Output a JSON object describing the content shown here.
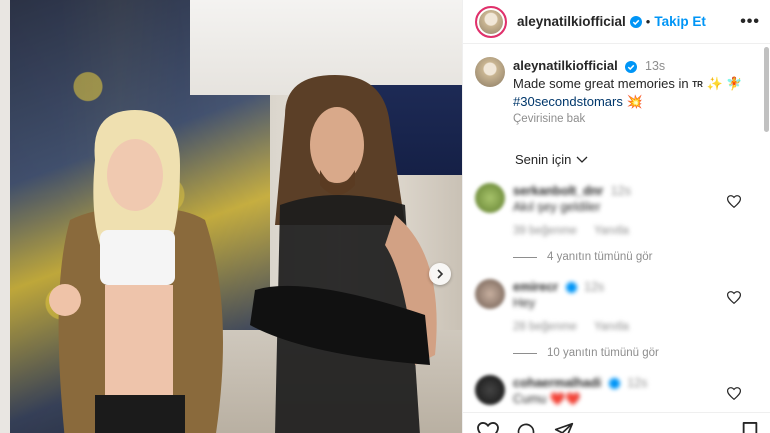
{
  "header": {
    "username": "aleynatilkiofficial",
    "separator": "•",
    "follow_label": "Takip Et",
    "more_label": "•••"
  },
  "caption": {
    "username": "aleynatilkiofficial",
    "time": "13s",
    "text": "Made some great memories in",
    "flag": "TR",
    "emojis": "✨ 🧚",
    "hashtag": "#30secondstomars",
    "hashtag_emoji": "💥",
    "translate": "Çevirisine bak"
  },
  "filter": {
    "label": "Senin için"
  },
  "comments": [
    {
      "username": "serkanbolt_dnr",
      "time": "12s",
      "text": "Akıl şey geldiler",
      "likes": "39 beğenme",
      "reply": "Yanıtla",
      "replies": "4 yanıtın tümünü gör"
    },
    {
      "username": "emirecr",
      "time": "12s",
      "text": "Hey",
      "likes": "28 beğenme",
      "reply": "Yanıtla",
      "replies": "10 yanıtın tümünü gör"
    },
    {
      "username": "cohaermalhadi",
      "time": "12s",
      "text": "Cumu ❤️❤️",
      "likes": "",
      "reply": "",
      "replies": ""
    }
  ],
  "colors": {
    "link": "#0095f6",
    "hashtag": "#00376b",
    "muted": "#8e8e8e",
    "ring": "#e1306c"
  },
  "icons": [
    "verified-badge-icon",
    "chevron-down-icon",
    "heart-icon",
    "comment-icon",
    "share-icon",
    "bookmark-icon",
    "chevron-right-icon"
  ]
}
